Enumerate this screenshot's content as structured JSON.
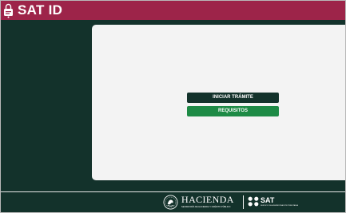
{
  "header": {
    "title": "SAT ID",
    "logo_icon": "lock-id-icon",
    "background_color": "#9d2449",
    "accent_line_color": "#13322b"
  },
  "main": {
    "background_color": "#13322b",
    "card_color": "#f3f3f3",
    "buttons": {
      "start_label": "INICIAR TRÁMITE",
      "start_color": "#13322b",
      "requirements_label": "REQUISITOS",
      "requirements_color": "#1d8a45"
    }
  },
  "footer": {
    "background_color": "#13322b",
    "hacienda": {
      "seal_icon": "mexican-seal-icon",
      "name": "HACIENDA",
      "subtitle": "SECRETARÍA DE HACIENDA Y CRÉDITO PÚBLICO"
    },
    "sat": {
      "logo_icon": "sat-logo-icon",
      "name": "SAT",
      "subtitle": "SERVICIO DE ADMINISTRACIÓN TRIBUTARIA"
    }
  }
}
